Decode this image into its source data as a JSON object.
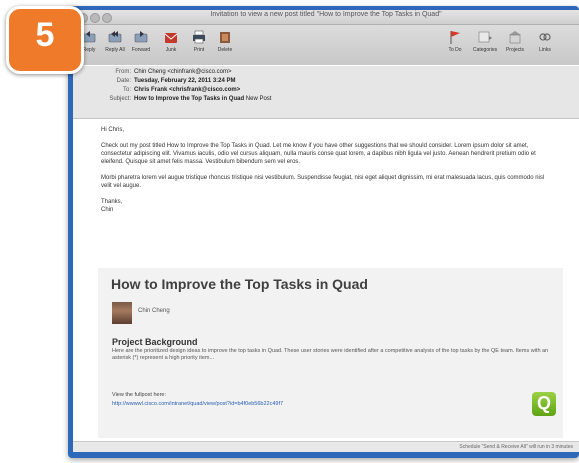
{
  "step_badge": {
    "number": "5",
    "color": "#ee7a2a"
  },
  "window": {
    "title": "Invitation to view a new post titled \"How to Improve the Top Tasks in Quad\"",
    "frame_color": "#2e68b8"
  },
  "toolbar": {
    "left": [
      {
        "label": "Reply",
        "icon": "reply-icon"
      },
      {
        "label": "Reply All",
        "icon": "reply-all-icon"
      },
      {
        "label": "Forward",
        "icon": "forward-icon"
      },
      {
        "label": "Junk",
        "icon": "junk-icon"
      },
      {
        "label": "Print",
        "icon": "print-icon"
      },
      {
        "label": "Delete",
        "icon": "delete-icon"
      }
    ],
    "right": [
      {
        "label": "To Do",
        "icon": "todo-flag-icon"
      },
      {
        "label": "Categories",
        "icon": "categories-icon"
      },
      {
        "label": "Projects",
        "icon": "projects-icon"
      },
      {
        "label": "Links",
        "icon": "links-icon"
      }
    ]
  },
  "headers": {
    "from_label": "From:",
    "from_value": "Chin Cheng <chinfrank@cisco.com>",
    "date_label": "Date:",
    "date_value": "Tuesday, February 22, 2011 3:24 PM",
    "to_label": "To:",
    "to_value": "Chris Frank <chrisfrank@cisco.com>",
    "subject_label": "Subject:",
    "subject_value": "How to Improve the Top Tasks in Quad",
    "subject_suffix": "New Post"
  },
  "body": {
    "greeting": "Hi Chris,",
    "para1": "Check out my post titled How to Improve the Top Tasks in Quad. Let me know if you have other suggestions that we should consider. Lorem ipsum dolor sit amet, consectetur adipiscing elit. Vivamus iaculis, odio vel cursus aliquam, nulla mauris conse quat lorem, a dapibus nibh ligula vel justo. Aenean hendrerit pretium odio et eleifend. Quisque sit amet felis massa. Vestibulum bibendum sem vel eros.",
    "para2": "Morbi pharetra lorem vel augue tristique rhoncus tristique nisi vestibulum. Suspendisse feugiat, nisi eget aliquet dignissim, mi erat malesuada lacus, quis commodo nisl velit vel augue.",
    "signoff": "Thanks,",
    "signature": "Chin"
  },
  "card": {
    "title": "How to Improve the Top Tasks in Quad",
    "author": "Chin Cheng",
    "section_title": "Project Background",
    "section_text": "Here are the prioritized design ideas to improve the top tasks in Quad. These user stories were identified after a competitive analysis of the top tasks by the QE team. Items with an asterisk (*) represent a high priority item...",
    "view_label": "View the fullpost here:",
    "view_link": "http://wwwwl.cisco.com/intranet/quad/view/post?id=b4f0eb56b22c49f7",
    "logo_letter": "Q",
    "logo_color": "#6db31f"
  },
  "statusbar": {
    "text": "Schedule \"Send & Receive All\" will run in 3 minutes"
  }
}
